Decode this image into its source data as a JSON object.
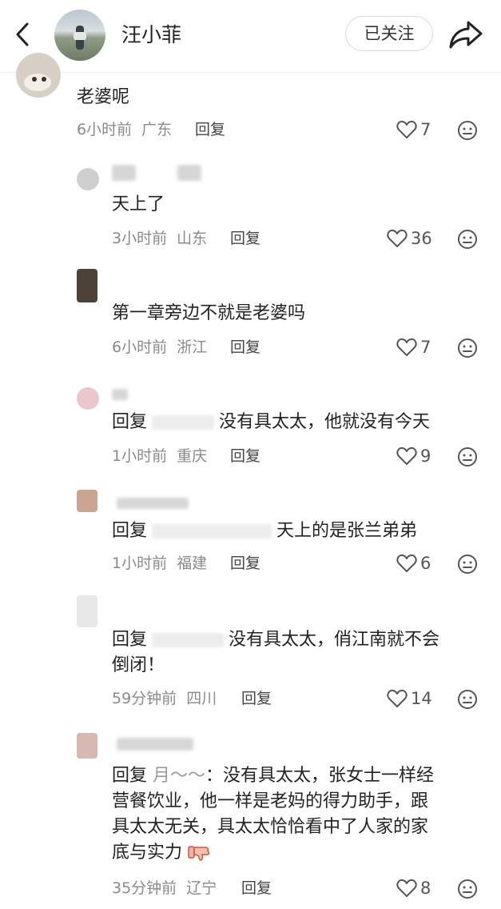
{
  "header": {
    "title": "汪小菲",
    "follow_label": "已关注"
  },
  "comments": [
    {
      "text": "老婆呢",
      "time": "6小时前",
      "location": "广东",
      "reply_label": "回复",
      "likes": "7"
    },
    {
      "text": "天上了",
      "time": "3小时前",
      "location": "山东",
      "reply_label": "回复",
      "likes": "36"
    },
    {
      "text": "第一章旁边不就是老婆吗",
      "time": "6小时前",
      "location": "浙江",
      "reply_label": "回复",
      "likes": "7"
    },
    {
      "prefix": "回复",
      "text": "没有具太太，他就没有今天",
      "time": "1小时前",
      "location": "重庆",
      "reply_label": "回复",
      "likes": "9"
    },
    {
      "prefix": "回复",
      "text": "天上的是张兰弟弟",
      "time": "1小时前",
      "location": "福建",
      "reply_label": "回复",
      "likes": "6"
    },
    {
      "prefix": "回复",
      "text": "没有具太太，俏江南就不会",
      "text2": "倒闭！",
      "time": "59分钟前",
      "location": "四川",
      "reply_label": "回复",
      "likes": "14"
    },
    {
      "prefix": "回复",
      "target": "月～～",
      "text": "没有具太太，张女士一样经",
      "text2": "营餐饮业，他一样是老妈的得力助手，跟",
      "text3": "具太太无关，具太太恰恰看中了人家的家",
      "text4": "底与实力",
      "time": "35分钟前",
      "location": "辽宁",
      "reply_label": "回复",
      "likes": "8"
    }
  ],
  "colors": {
    "muted": "#8a8a8a",
    "text": "#222222",
    "divider": "#efefef"
  }
}
